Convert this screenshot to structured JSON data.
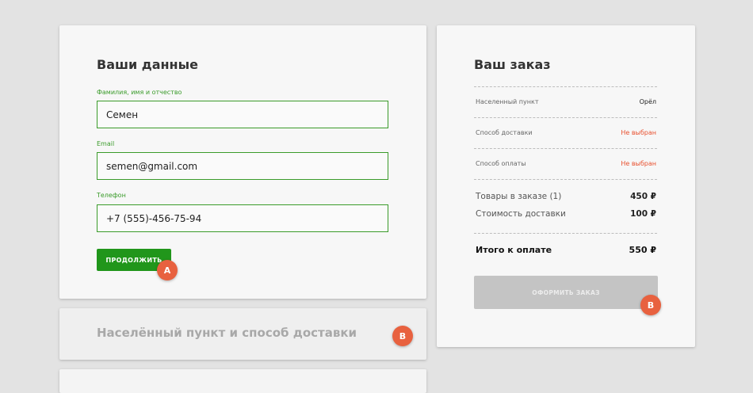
{
  "contact": {
    "title": "Ваши данные",
    "name_label": "Фамилия, имя и отчество",
    "name_value": "Семен",
    "email_label": "Email",
    "email_value": "semen@gmail.com",
    "phone_label": "Телефон",
    "phone_value": "+7 (555)-456-75-94",
    "continue_label": "ПРОДОЛЖИТЬ",
    "marker_a": "A"
  },
  "delivery": {
    "title": "Населённый пункт и способ доставки",
    "marker_b": "B"
  },
  "order": {
    "title": "Ваш заказ",
    "rows": [
      {
        "label": "Населенный пункт",
        "value": "Орёл"
      },
      {
        "label": "Способ доставки",
        "value": "Не выбран"
      },
      {
        "label": "Способ оплаты",
        "value": "Не выбран"
      }
    ],
    "items_label": "Товары в заказе (1)",
    "items_value": "450 ₽",
    "shipping_label": "Стоимость доставки",
    "shipping_value": "100 ₽",
    "total_label": "Итого к оплате",
    "total_value": "550 ₽",
    "checkout_label": "ОФОРМИТЬ ЗАКАЗ",
    "marker_b": "B"
  },
  "colors": {
    "accent": "#21961b",
    "warning": "#e8502e",
    "marker": "#e8613f"
  }
}
